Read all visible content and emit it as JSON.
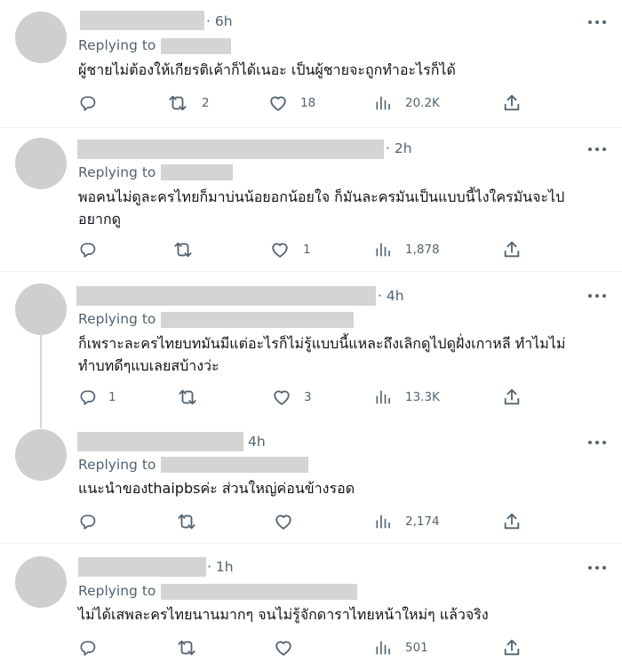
{
  "replying_label": "Replying to",
  "tweets": [
    {
      "time": "· 6h",
      "text": "ผู้ชายไม่ต้องให้เกียรติเค้าก็ได้เนอะ เป็นผู้ชายจะถูกทำอะไรก็ได้",
      "replies": "",
      "retweets": "2",
      "likes": "18",
      "views": "20.2K"
    },
    {
      "time": "· 2h",
      "text": "พอคนไม่ดูละครไทยก็มาบ่นน้อยอกน้อยใจ ก็มันละครมันเป็นแบบนี้ไงใครมันจะไป\nอยากดู",
      "replies": "",
      "retweets": "",
      "likes": "1",
      "views": "1,878"
    },
    {
      "time": "· 4h",
      "text": "ก็เพราะละครไทยบทมันมีแต่อะไรก็ไม่รู้แบบนี้แหละถึงเลิกดูไปดูฝั่งเกาหลี ทำไมไม่\nทำบทดีๆแบเลยสบ้างว่ะ",
      "replies": "1",
      "retweets": "",
      "likes": "3",
      "views": "13.3K"
    },
    {
      "time": "4h",
      "text": "แนะนำของthaipbsค่ะ ส่วนใหญ่ค่อนข้างรอด",
      "replies": "",
      "retweets": "",
      "likes": "",
      "views": "2,174"
    },
    {
      "time": "· 1h",
      "text": "ไม่ได้เสพละครไทยนานมากๆ จนไม่รู้จักดาราไทยหน้าใหม่ๆ แล้วจริง",
      "replies": "",
      "retweets": "",
      "likes": "",
      "views": "501"
    }
  ],
  "icons": {
    "reply": "reply-icon",
    "retweet": "retweet-icon",
    "like": "heart-icon",
    "views": "views-icon",
    "share": "share-icon",
    "more": "more-icon"
  },
  "colors": {
    "text": "#0f1419",
    "muted": "#536471",
    "redacted": "#d4d4d4",
    "avatar": "#cfcfcf",
    "divider": "#eff3f4"
  }
}
